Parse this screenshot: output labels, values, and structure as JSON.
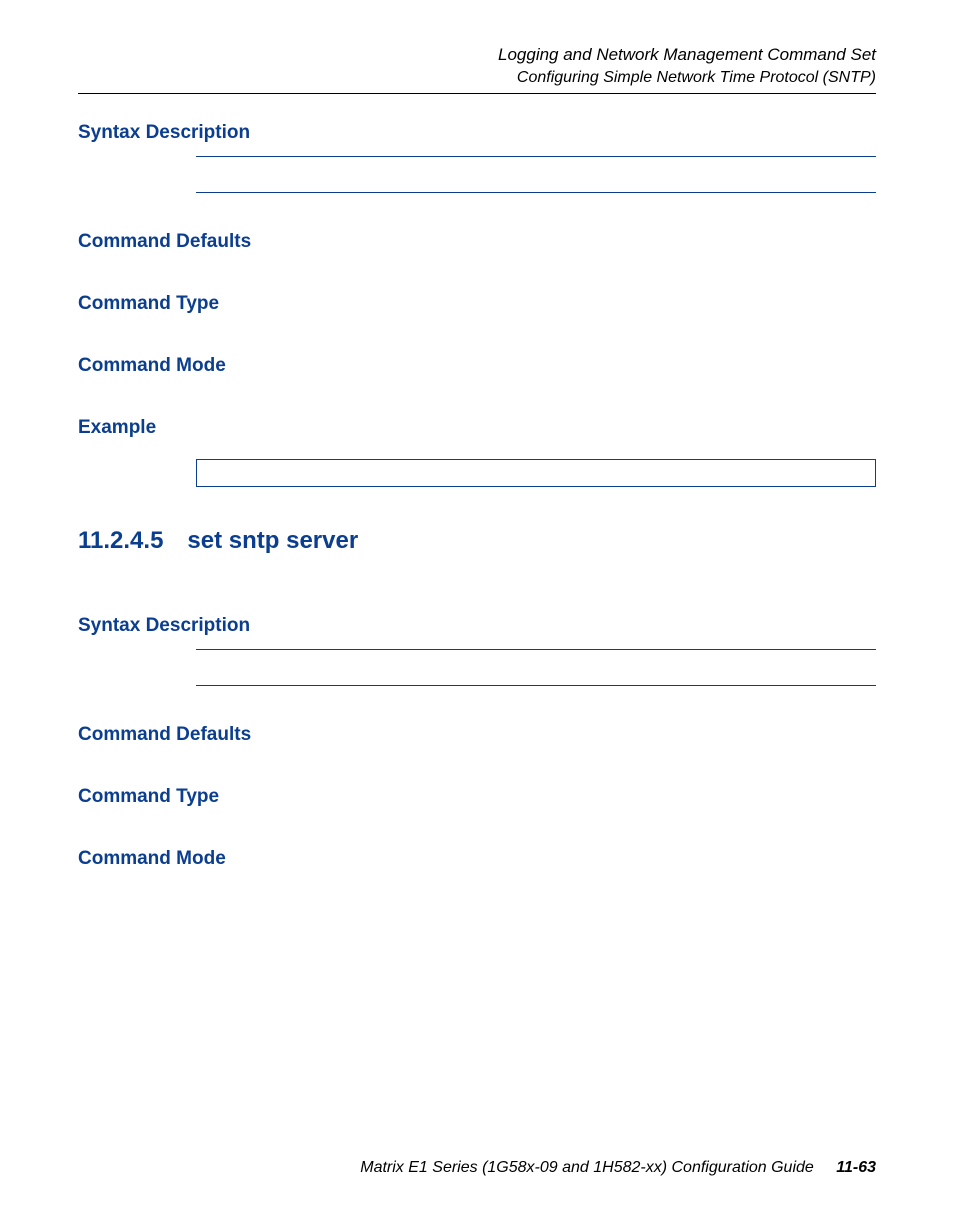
{
  "header": {
    "line1": "Logging and Network Management Command Set",
    "line2": "Configuring Simple Network Time Protocol (SNTP)"
  },
  "section1": {
    "syntax_description": "Syntax Description",
    "command_defaults": "Command Defaults",
    "command_type": "Command Type",
    "command_mode": "Command Mode",
    "example": "Example"
  },
  "main_heading": "11.2.4.5 set sntp server",
  "section2": {
    "syntax_description": "Syntax Description",
    "command_defaults": "Command Defaults",
    "command_type": "Command Type",
    "command_mode": "Command Mode"
  },
  "footer": {
    "text": "Matrix E1 Series (1G58x-09 and 1H582-xx) Configuration Guide",
    "page": "11-63"
  }
}
